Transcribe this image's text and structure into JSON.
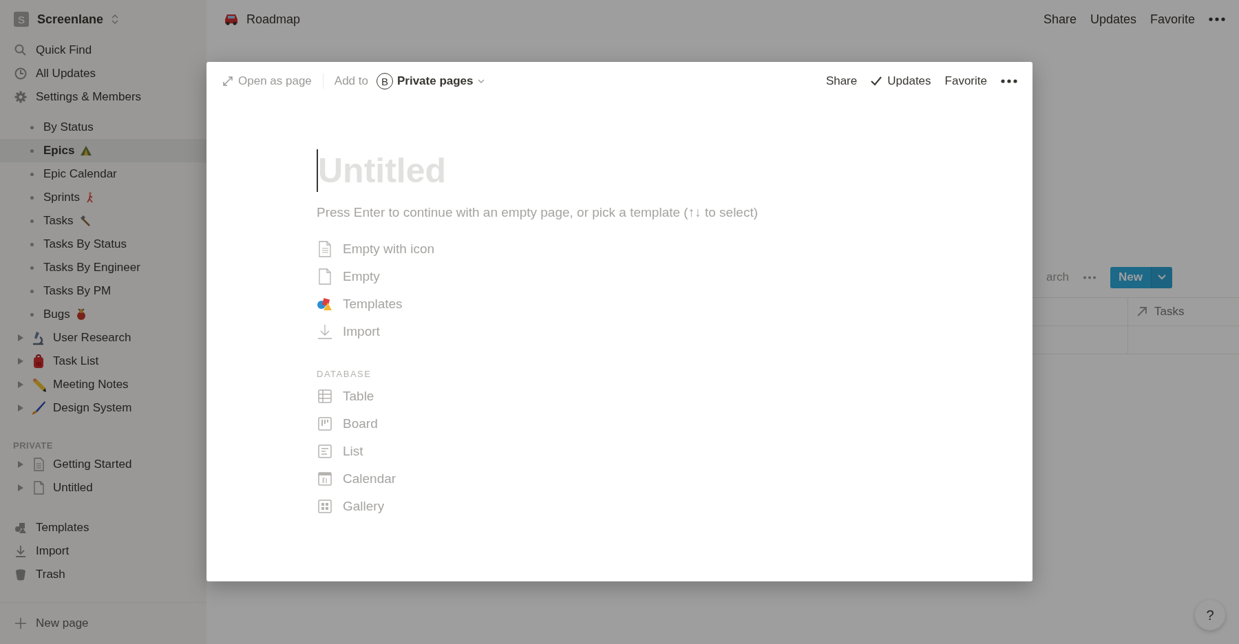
{
  "sidebar": {
    "workspace": {
      "initial": "S",
      "name": "Screenlane"
    },
    "nav": [
      {
        "label": "Quick Find",
        "kind": "search"
      },
      {
        "label": "All Updates",
        "kind": "clock"
      },
      {
        "label": "Settings & Members",
        "kind": "gear"
      }
    ],
    "views": [
      {
        "label": "By Status",
        "selected": false,
        "kind": "plain"
      },
      {
        "label": "Epics",
        "selected": true,
        "kind": "tent"
      },
      {
        "label": "Epic Calendar",
        "selected": false,
        "kind": "plain"
      },
      {
        "label": "Sprints",
        "selected": false,
        "kind": "runner"
      },
      {
        "label": "Tasks",
        "selected": false,
        "kind": "hammer"
      },
      {
        "label": "Tasks By Status",
        "selected": false,
        "kind": "plain"
      },
      {
        "label": "Tasks By Engineer",
        "selected": false,
        "kind": "plain"
      },
      {
        "label": "Tasks By PM",
        "selected": false,
        "kind": "plain"
      },
      {
        "label": "Bugs",
        "selected": false,
        "kind": "bug"
      }
    ],
    "pages": [
      {
        "label": "User Research",
        "selected": false,
        "kind": "microscope"
      },
      {
        "label": "Task List",
        "selected": false,
        "kind": "backpack"
      },
      {
        "label": "Meeting Notes",
        "selected": false,
        "kind": "pencil"
      },
      {
        "label": "Design System",
        "selected": false,
        "kind": "brush"
      }
    ],
    "private_heading": "PRIVATE",
    "private_pages": [
      {
        "label": "Getting Started",
        "selected": false,
        "kind": "doc"
      },
      {
        "label": "Untitled",
        "selected": false,
        "kind": "blank"
      }
    ],
    "footer": [
      {
        "label": "Templates",
        "kind": "shapes"
      },
      {
        "label": "Import",
        "kind": "download"
      },
      {
        "label": "Trash",
        "kind": "trash"
      }
    ],
    "new_page": "New page"
  },
  "topbar": {
    "title": "Roadmap",
    "actions": [
      "Share",
      "Updates",
      "Favorite"
    ]
  },
  "database": {
    "search_fragment": "arch",
    "new_button": "New",
    "columns": [
      "Tasks"
    ]
  },
  "help": "?",
  "modal": {
    "open_as_page": "Open as page",
    "add_to": "Add to",
    "workspace_initial": "B",
    "workspace": "Private pages",
    "actions": [
      {
        "label": "Share",
        "checked": false
      },
      {
        "label": "Updates",
        "checked": true
      },
      {
        "label": "Favorite",
        "checked": false
      }
    ],
    "title": {
      "placeholder": "Untitled"
    },
    "hint": "Press Enter to continue with an empty page, or pick a template (↑↓ to select)",
    "templates": [
      {
        "label": "Empty with icon",
        "kind": "doc"
      },
      {
        "label": "Empty",
        "kind": "blank"
      },
      {
        "label": "Templates",
        "kind": "shapes"
      },
      {
        "label": "Import",
        "kind": "download"
      }
    ],
    "database_heading": "DATABASE",
    "databases": [
      {
        "label": "Table",
        "kind": "table"
      },
      {
        "label": "Board",
        "kind": "board"
      },
      {
        "label": "List",
        "kind": "list"
      },
      {
        "label": "Calendar",
        "kind": "calendar"
      },
      {
        "label": "Gallery",
        "kind": "gallery"
      }
    ]
  }
}
